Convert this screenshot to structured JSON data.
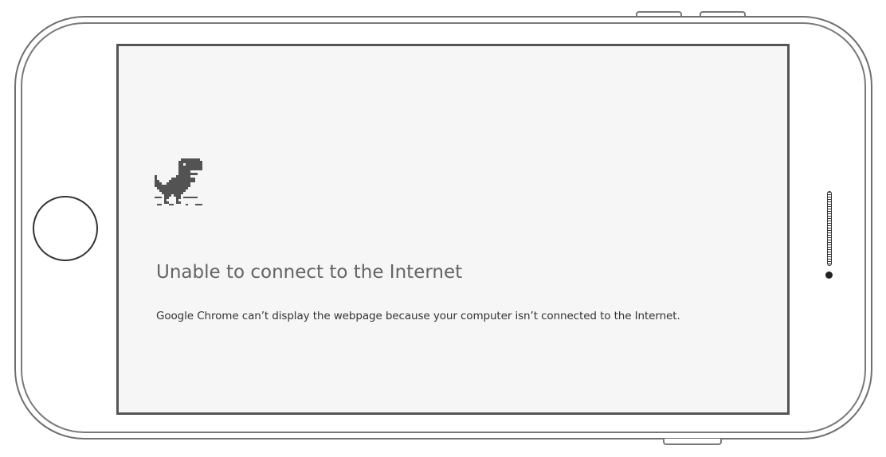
{
  "device": {
    "frame_color": "#6f6f6f",
    "screen_background": "#f6f6f6"
  },
  "error_page": {
    "icon": "offline-dino-icon",
    "title": "Unable to connect to the Internet",
    "message": "Google Chrome can’t display the webpage because your computer isn’t connected to the Internet.",
    "title_color": "#646464",
    "message_color": "#333333"
  }
}
